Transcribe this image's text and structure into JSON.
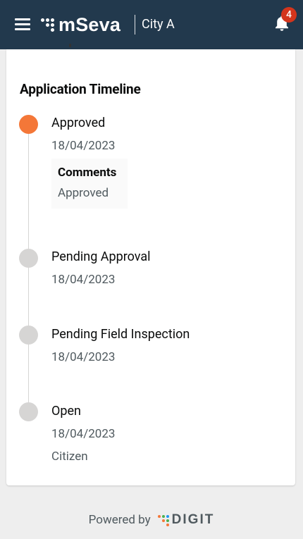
{
  "header": {
    "brand": "mSeva",
    "city": "City A",
    "notification_count": "4"
  },
  "timeline": {
    "title": "Application Timeline",
    "steps": [
      {
        "title": "Approved",
        "date": "18/04/2023",
        "active": true,
        "comments_label": "Comments",
        "comments_value": "Approved"
      },
      {
        "title": "Pending Approval",
        "date": "18/04/2023",
        "active": false
      },
      {
        "title": "Pending Field Inspection",
        "date": "18/04/2023",
        "active": false
      },
      {
        "title": "Open",
        "date": "18/04/2023",
        "active": false,
        "extra": "Citizen"
      }
    ]
  },
  "footer": {
    "powered_by": "Powered by",
    "brand": "DIGIT"
  },
  "colors": {
    "header_bg": "#22394d",
    "active_step": "#f47738",
    "inactive_step": "#d6d5d4",
    "badge": "#d4351c"
  }
}
